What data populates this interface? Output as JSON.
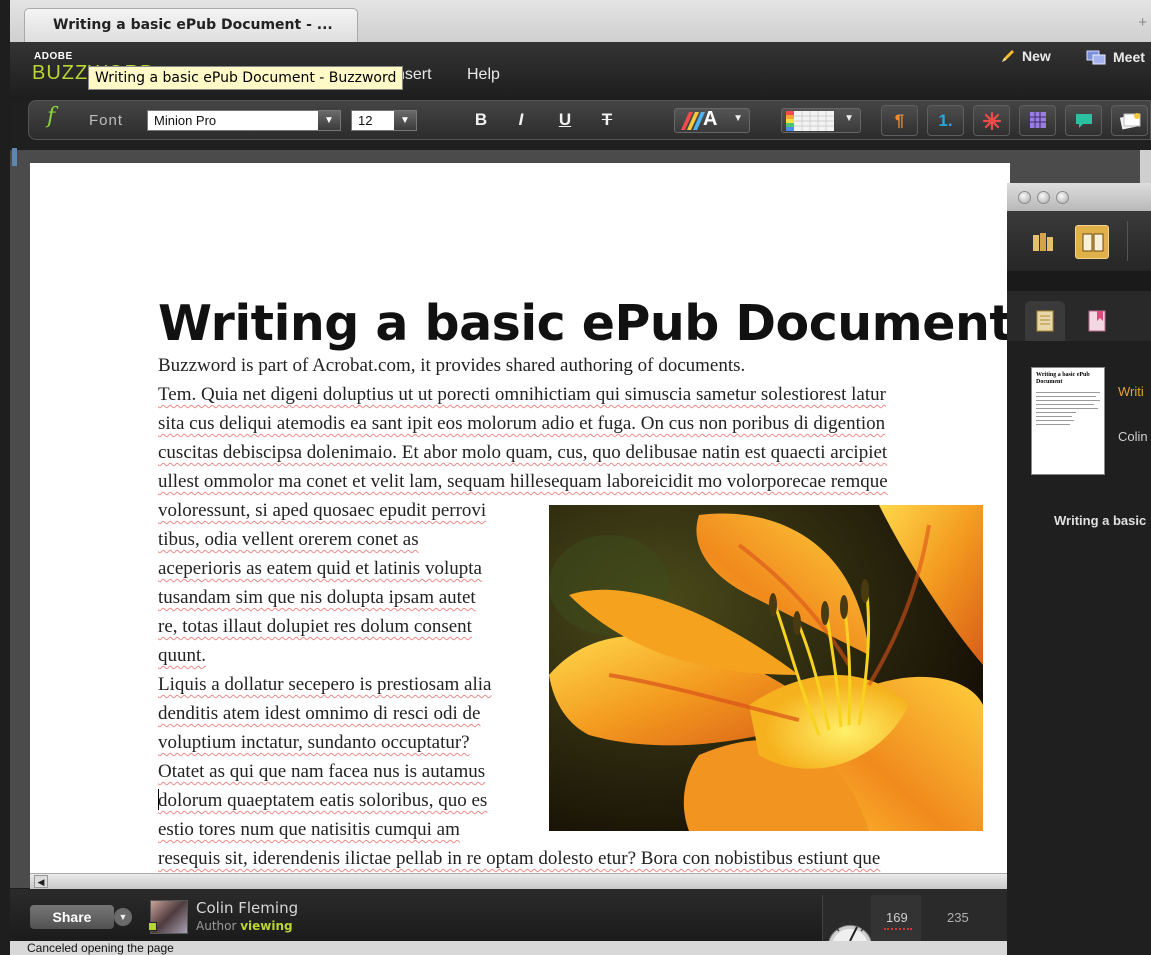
{
  "browser": {
    "tab_title": "Writing a basic ePub Document - ...",
    "new_tab": "+"
  },
  "app": {
    "brand_top": "ADOBE",
    "brand_main": "BUZZWORD",
    "menu": [
      "nsert",
      "Help"
    ],
    "tooltip": "Writing a basic ePub Document - Buzzword",
    "actions": {
      "new_label": "New",
      "meet_label": "Meet"
    }
  },
  "toolbar": {
    "fx_glyph": "f",
    "font_label": "Font",
    "font_family": "Minion Pro",
    "font_size": "12",
    "bold": "B",
    "italic": "I",
    "underline": "U",
    "strike": "T",
    "text_color_glyph": "A",
    "paragraph_glyph": "¶",
    "numbering_glyph": "1.",
    "colors": {
      "fx": "#8bd23a",
      "paragraph": "#f08a2a",
      "numbering": "#2aa6e0",
      "special": "#f04a4a",
      "table": "#9a7de0",
      "comment": "#2ac0a0"
    }
  },
  "document": {
    "title": "Writing a basic ePub Document",
    "paragraphs_full": [
      [
        "Buzzword is part of Acrobat.com, it provides shared authoring of documents."
      ],
      [
        "Tem. Quia net digeni doluptius ut ut porecti omnihictiam qui simuscia sametur solestiorest latur",
        "sita cus deliqui atemodis ea sant ipit eos molorum adio et fuga. On cus non poribus di digention",
        "cuscitas debiscipsa dolenimaio. Et abor molo quam, cus, quo delibusae natin est quaecti arcipiet",
        "ullest ommolor ma conet et velit lam, sequam hillesequam laboreicidit mo volorporecae remque"
      ]
    ],
    "wrap_lines": [
      "voloressunt, si aped quosaec epudit perrovi",
      "tibus, odia vellent orerem conet as",
      "aceperioris as eatem quid et latinis volupta",
      "tusandam sim que nis dolupta ipsam autet",
      "re, totas illaut dolupiet res dolum consent",
      "quunt.",
      "Liquis a dollatur secepero is prestiosam alia",
      "denditis atem idest omnimo di resci odi de",
      "voluptium inctatur, sundanto occuptatur?",
      "Otatet as qui que nam facea nus is autamus",
      "dolorum quaeptatem eatis soloribus, quo es",
      "estio tores num que natisitis cumqui am"
    ],
    "last_line": "resequis sit, iderendenis ilictae pellab in re optam dolesto etur? Bora con nobistibus estiunt que",
    "image_icon": "lily-flower-photo"
  },
  "footer": {
    "share_label": "Share",
    "user_name": "Colin Fleming",
    "user_role": "Author",
    "user_state": "viewing",
    "page_current": "169",
    "page_total": "235",
    "status": "Canceled opening the page"
  },
  "side_panel": {
    "thumb_title": "Writing a basic ePub Document",
    "doc_title": "Writi",
    "doc_author": "Colin",
    "caption": "Writing a basic"
  }
}
